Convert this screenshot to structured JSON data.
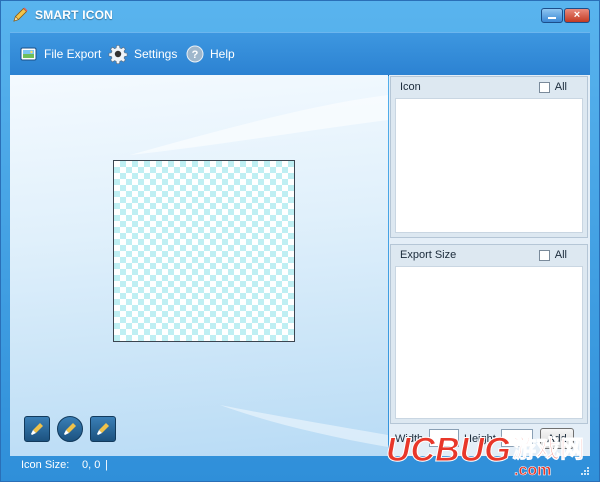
{
  "window": {
    "title": "SMART ICON",
    "close_glyph": "×"
  },
  "toolbar": {
    "items": [
      {
        "label": "File Export",
        "icon": "file-export-icon"
      },
      {
        "label": "Settings",
        "icon": "gear-icon"
      },
      {
        "label": "Help",
        "icon": "help-icon"
      }
    ]
  },
  "right_panel": {
    "icon_section": {
      "title": "Icon",
      "all_label": "All",
      "all_checked": false
    },
    "export_section": {
      "title": "Export Size",
      "all_label": "All",
      "all_checked": false
    },
    "size_row": {
      "width_label": "Width",
      "width_value": "",
      "height_label": "Height",
      "height_value": "",
      "add_label": "Add"
    }
  },
  "tools": [
    {
      "name": "brush-tool-1",
      "icon": "brush-icon"
    },
    {
      "name": "brush-tool-2",
      "icon": "brush-icon"
    },
    {
      "name": "brush-tool-3",
      "icon": "brush-icon"
    }
  ],
  "status": {
    "label": "Icon Size:",
    "value": "0, 0",
    "separator": "|"
  },
  "watermark": {
    "brand": "UCBUG",
    "chinese": "游戏网",
    "domain": ".com"
  },
  "colors": {
    "frame": "#3a97de",
    "toolbar": "#2f86d5",
    "checker": "#bfeff3",
    "watermark_red": "#e8372a"
  }
}
